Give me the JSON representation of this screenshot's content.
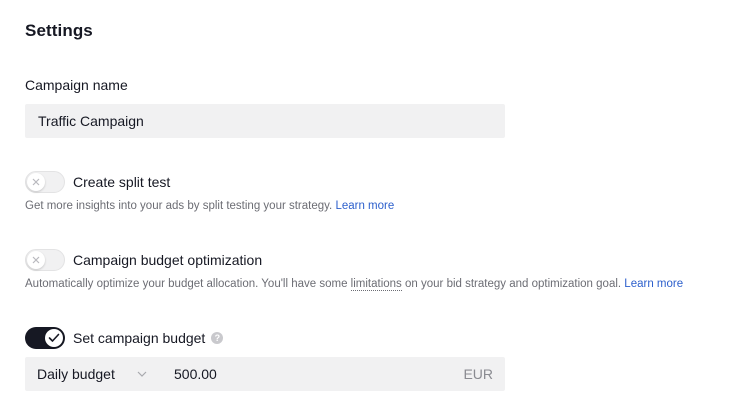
{
  "header": {
    "title": "Settings"
  },
  "campaign_name": {
    "label": "Campaign name",
    "value": "Traffic Campaign"
  },
  "split_test": {
    "label": "Create split test",
    "enabled": false,
    "description": "Get more insights into your ads by split testing your strategy.",
    "link": "Learn more"
  },
  "budget_optimization": {
    "label": "Campaign budget optimization",
    "enabled": false,
    "description_before": "Automatically optimize your budget allocation. You'll have some",
    "description_term": "limitations",
    "description_after": "on your bid strategy and optimization goal.",
    "link": "Learn more"
  },
  "campaign_budget": {
    "label": "Set campaign budget",
    "enabled": true,
    "help_icon": "question-circle-icon",
    "help_glyph": "?",
    "type_selected": "Daily budget",
    "amount": "500.00",
    "currency": "EUR"
  },
  "colors": {
    "text_primary": "#161823",
    "text_secondary": "#6c6d74",
    "link": "#2c5fcc",
    "field_bg": "#f1f1f2",
    "toggle_on": "#161823"
  }
}
